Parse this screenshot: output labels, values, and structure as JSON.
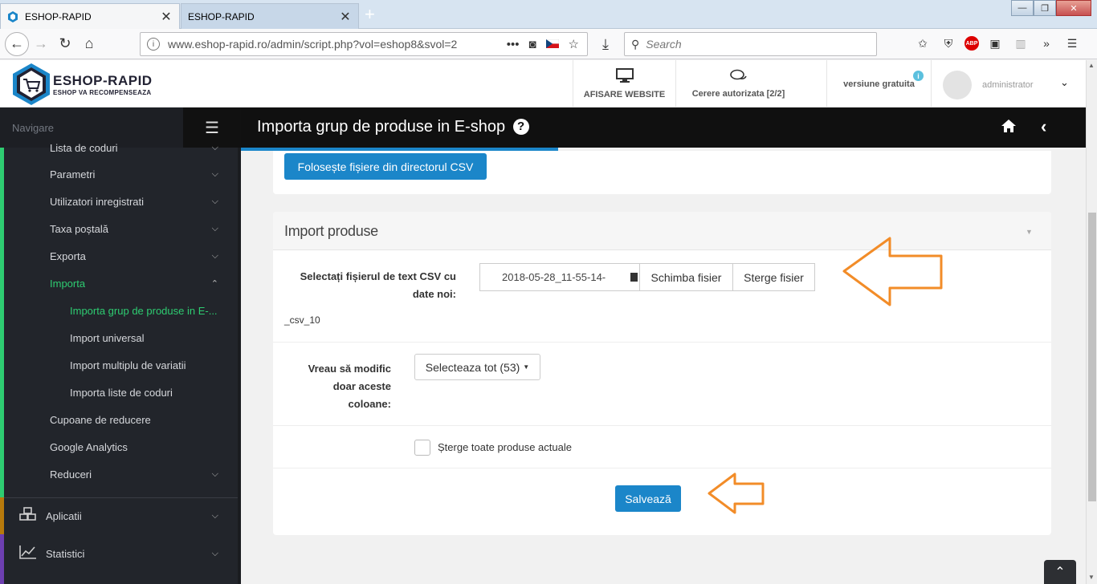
{
  "browser": {
    "tabs": [
      {
        "title": "ESHOP-RAPID",
        "active": true
      },
      {
        "title": "ESHOP-RAPID",
        "active": false
      }
    ],
    "url": "www.eshop-rapid.ro/admin/script.php?vol=eshop8&svol=2",
    "search_placeholder": "Search",
    "window_controls": {
      "minimize": "—",
      "maximize": "❐",
      "close": "✕"
    }
  },
  "header": {
    "logo_title": "ESHOP-RAPID",
    "logo_subtitle": "ESHOP VA RECOMPENSEAZA",
    "website_label": "AFISARE WEBSITE",
    "requests_label": "Cerere autorizata [2/2]",
    "version_label": "versiune gratuita",
    "user_name": "administrator"
  },
  "sidebar": {
    "nav_label": "Navigare",
    "items": [
      {
        "label": "Lista de coduri",
        "level": 1,
        "expandable": true
      },
      {
        "label": "Parametri",
        "level": 1,
        "expandable": true
      },
      {
        "label": "Utilizatori inregistrati",
        "level": 1,
        "expandable": true
      },
      {
        "label": "Taxa poștală",
        "level": 1,
        "expandable": true
      },
      {
        "label": "Exporta",
        "level": 1,
        "expandable": true
      },
      {
        "label": "Importa",
        "level": 1,
        "expandable": true,
        "active": true,
        "expanded": true
      },
      {
        "label": "Importa grup de produse in E-...",
        "level": 2,
        "active": true
      },
      {
        "label": "Import universal",
        "level": 2
      },
      {
        "label": "Import multiplu de variatii",
        "level": 2
      },
      {
        "label": "Importa liste de coduri",
        "level": 2
      },
      {
        "label": "Cupoane de reducere",
        "level": 1
      },
      {
        "label": "Google Analytics",
        "level": 1
      },
      {
        "label": "Reduceri",
        "level": 1,
        "expandable": true
      }
    ],
    "main_items": [
      {
        "label": "Aplicatii",
        "icon": "cubes-icon"
      },
      {
        "label": "Statistici",
        "icon": "line-chart-icon"
      }
    ]
  },
  "page": {
    "title": "Importa grup de produse in E-shop",
    "csv_dir_button": "Folosește fișiere din directorul CSV",
    "panel_title": "Import produse",
    "file_label": "Selectați fișierul de text CSV cu date noi:",
    "file_name": "2018-05-28_11-55-14-",
    "file_name_tail": "_csv_10",
    "change_file_button": "Schimba fisier",
    "delete_file_button": "Sterge fisier",
    "columns_label": "Vreau să modific doar aceste coloane:",
    "columns_dropdown": "Selecteaza tot (53)",
    "delete_all_label": "Șterge toate produse actuale",
    "delete_all_checked": false,
    "save_button": "Salvează"
  },
  "colors": {
    "accent_blue": "#1b86c9",
    "sidebar_bg": "#22252b",
    "active_green": "#2ecc71",
    "arrow_orange": "#f28c28"
  }
}
